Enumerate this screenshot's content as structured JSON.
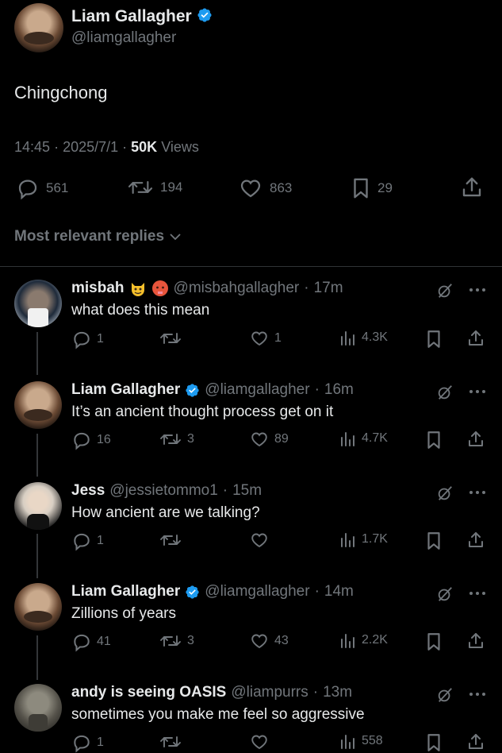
{
  "post": {
    "author_name": "Liam Gallagher",
    "author_handle": "@liamgallagher",
    "text": "Chingchong",
    "time": "14:45",
    "date": "2025/7/1",
    "views_count": "50K",
    "views_label": "Views",
    "replies": "561",
    "reposts": "194",
    "likes": "863",
    "bookmarks": "29"
  },
  "replies_header": "Most relevant replies",
  "replies": [
    {
      "name": "misbah",
      "handle": "@misbahgallagher",
      "time": "17m",
      "text": "what does this mean",
      "replies": "1",
      "reposts": "",
      "likes": "1",
      "views": "4.3K",
      "emojis": [
        "smiling-cat-emoji",
        "hot-face-emoji"
      ]
    },
    {
      "name": "Liam Gallagher",
      "handle": "@liamgallagher",
      "time": "16m",
      "text": "It’s an ancient thought process get on it",
      "replies": "16",
      "reposts": "3",
      "likes": "89",
      "views": "4.7K"
    },
    {
      "name": "Jess",
      "handle": "@jessietommo1",
      "time": "15m",
      "text": "How ancient are we talking?",
      "replies": "1",
      "reposts": "",
      "likes": "",
      "views": "1.7K"
    },
    {
      "name": "Liam Gallagher",
      "handle": "@liamgallagher",
      "time": "14m",
      "text": "Zillions of years",
      "replies": "41",
      "reposts": "3",
      "likes": "43",
      "views": "2.2K"
    },
    {
      "name": "andy is seeing OASIS",
      "handle": "@liampurrs",
      "time": "13m",
      "text": "sometimes you make me feel so aggressive",
      "replies": "1",
      "reposts": "",
      "likes": "",
      "views": "558"
    }
  ],
  "colors": {
    "background": "#000000",
    "text": "#e7e9ea",
    "muted": "#71767b",
    "verified": "#1d9bf0",
    "divider": "#2f3336"
  }
}
